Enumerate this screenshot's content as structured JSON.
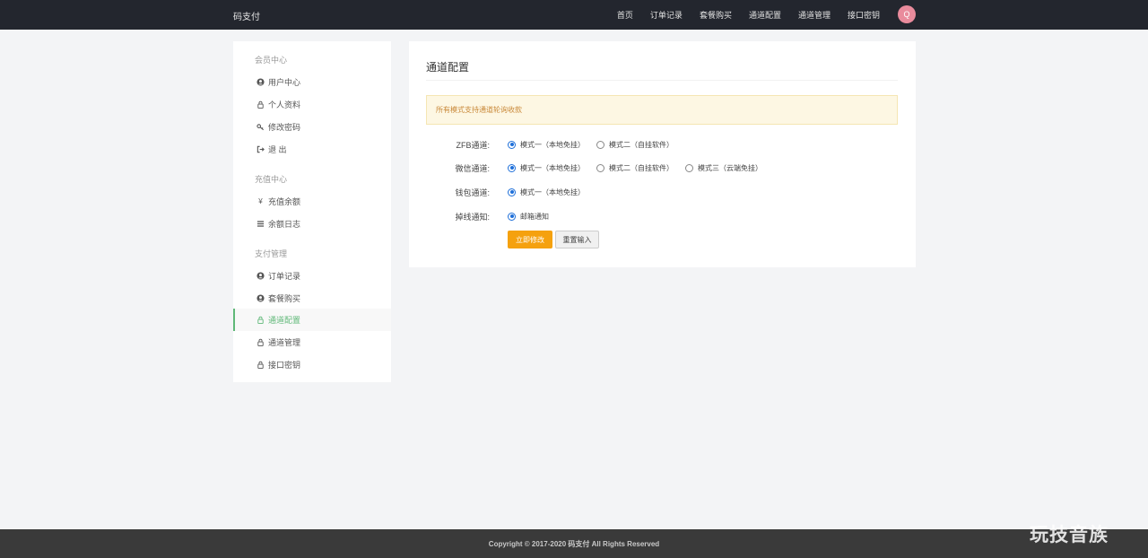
{
  "header": {
    "brand": "码支付",
    "nav": [
      "首页",
      "订单记录",
      "套餐购买",
      "通道配置",
      "通道管理",
      "接口密钥"
    ],
    "avatar_letter": "Q",
    "avatar_color": "#e98b9c"
  },
  "sidebar": {
    "groups": [
      {
        "title": "会员中心",
        "items": [
          {
            "label": "用户中心",
            "icon": "user-circle-icon"
          },
          {
            "label": "个人资料",
            "icon": "lock-icon"
          },
          {
            "label": "修改密码",
            "icon": "key-icon"
          },
          {
            "label": "退 出",
            "icon": "sign-out-icon"
          }
        ]
      },
      {
        "title": "充值中心",
        "items": [
          {
            "label": "充值余额",
            "icon": "yen-icon"
          },
          {
            "label": "余额日志",
            "icon": "list-icon"
          }
        ]
      },
      {
        "title": "支付管理",
        "items": [
          {
            "label": "订单记录",
            "icon": "user-circle-icon"
          },
          {
            "label": "套餐购买",
            "icon": "user-circle-icon"
          },
          {
            "label": "通道配置",
            "icon": "lock-icon",
            "active": true
          },
          {
            "label": "通道管理",
            "icon": "lock-icon"
          },
          {
            "label": "接口密钥",
            "icon": "lock-icon"
          }
        ]
      }
    ],
    "active_color": "#5fb878"
  },
  "main": {
    "title": "通道配置",
    "notice": "所有模式支持通道轮询收款",
    "form": {
      "rows": [
        {
          "label": "ZFB通道:",
          "options": [
            {
              "text": "模式一（本地免挂）",
              "checked": true
            },
            {
              "text": "模式二（自挂软件）",
              "checked": false
            }
          ]
        },
        {
          "label": "微信通道:",
          "options": [
            {
              "text": "模式一（本地免挂）",
              "checked": true
            },
            {
              "text": "模式二（自挂软件）",
              "checked": false
            },
            {
              "text": "模式三（云端免挂）",
              "checked": false
            }
          ]
        },
        {
          "label": "钱包通道:",
          "options": [
            {
              "text": "模式一（本地免挂）",
              "checked": true
            }
          ]
        },
        {
          "label": "掉线通知:",
          "options": [
            {
              "text": "邮箱通知",
              "checked": true
            }
          ]
        }
      ]
    },
    "submit_label": "立即修改",
    "reset_label": "重置输入",
    "submit_color": "#f5a10e"
  },
  "footer": {
    "copyright": "Copyright © 2017-2020 码支付 All Rights Reserved"
  },
  "watermark": "玩技音族"
}
